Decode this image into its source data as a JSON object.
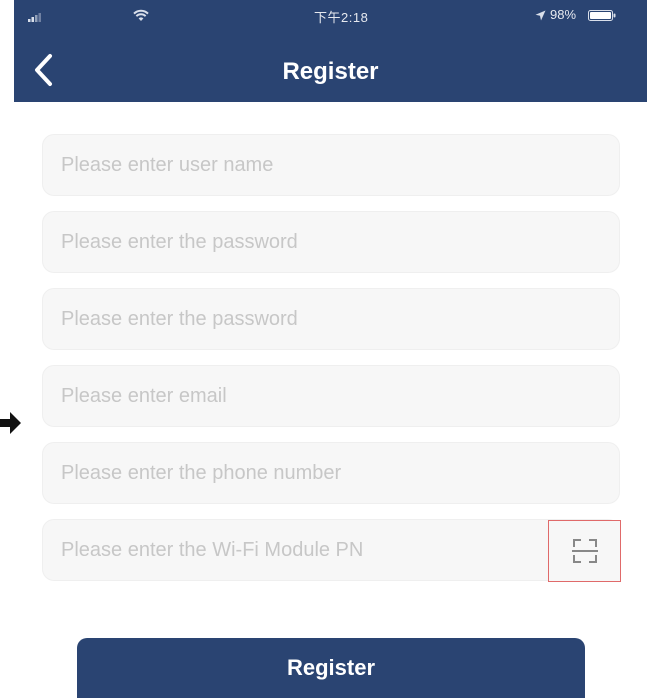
{
  "status_bar": {
    "time": "下午2:18",
    "battery": "98%"
  },
  "nav": {
    "title": "Register"
  },
  "form": {
    "username_placeholder": "Please enter user name",
    "password_placeholder": "Please enter the password",
    "confirm_password_placeholder": "Please enter the password",
    "email_placeholder": "Please enter email",
    "phone_placeholder": "Please enter the phone number",
    "wifi_pn_placeholder": "Please enter the Wi-Fi Module PN"
  },
  "icons": {
    "back": "chevron-left-icon",
    "scan": "scan-qr-icon",
    "pointer": "arrow-right-icon"
  },
  "register_label": "Register",
  "colors": {
    "primary": "#2a4472",
    "field_bg": "#f7f7f7",
    "placeholder": "#c7c7c7",
    "highlight_box": "#e06a6a"
  }
}
